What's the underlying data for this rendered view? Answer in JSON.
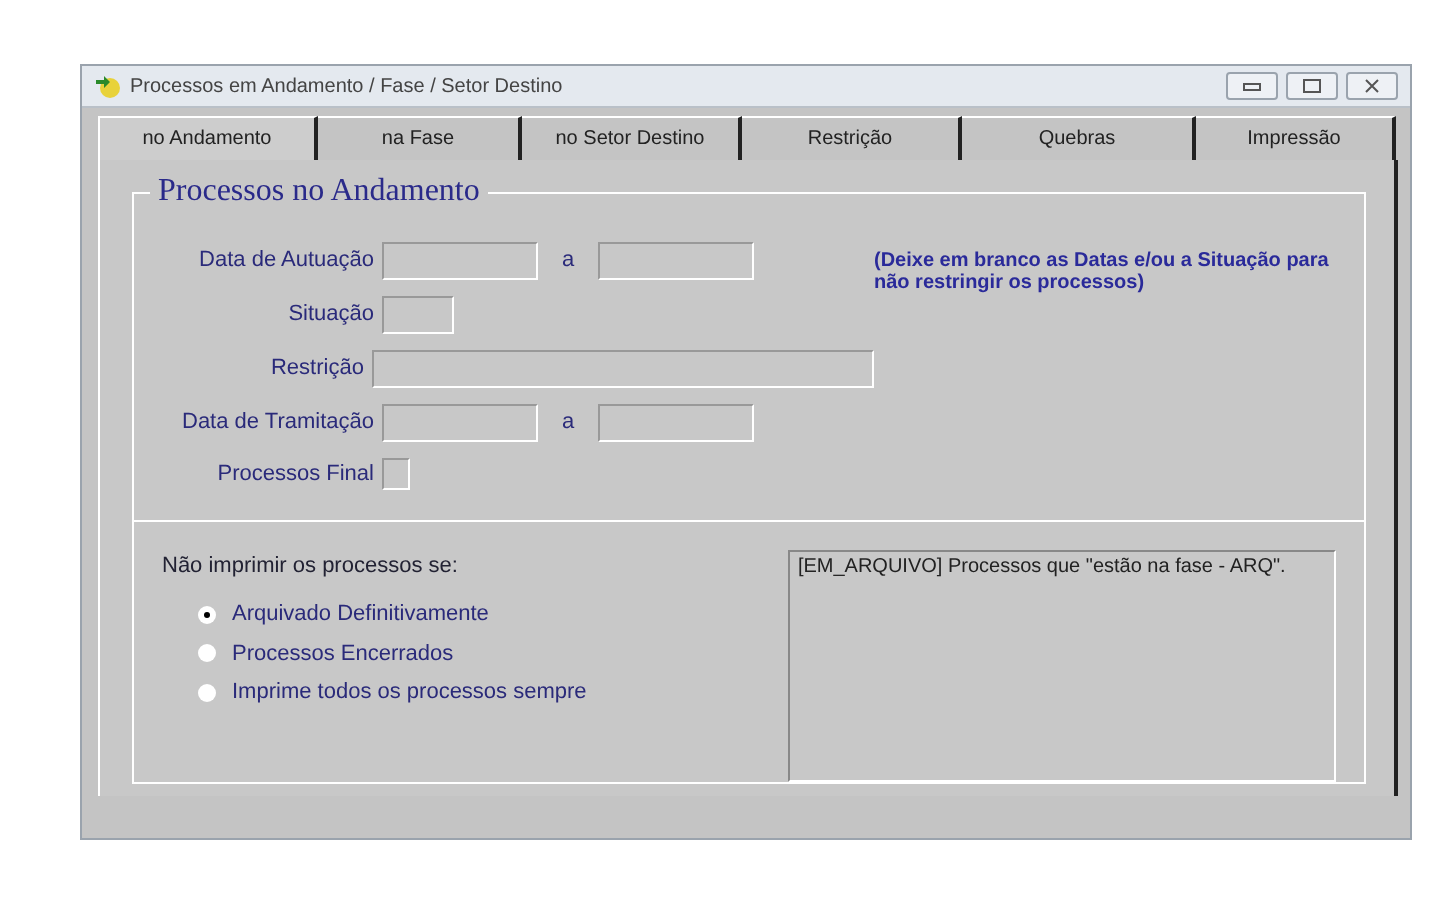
{
  "window": {
    "title": "Processos em Andamento / Fase / Setor Destino"
  },
  "tabs": [
    {
      "label": "no Andamento",
      "selected": true
    },
    {
      "label": "na Fase",
      "selected": false
    },
    {
      "label": "no Setor Destino",
      "selected": false
    },
    {
      "label": "Restrição",
      "selected": false
    },
    {
      "label": "Quebras",
      "selected": false
    },
    {
      "label": "Impressão",
      "selected": false
    }
  ],
  "group": {
    "title": "Processos no Andamento",
    "hint": "(Deixe em branco as Datas e/ou a Situação para não restringir os processos)",
    "fields": [
      {
        "kind": "range",
        "label": "Data de Autuação",
        "separator": "a"
      },
      {
        "kind": "short",
        "label": "Situação"
      },
      {
        "kind": "wide",
        "label": "Restrição"
      },
      {
        "kind": "range",
        "label": "Data de Tramitação",
        "separator": "a"
      },
      {
        "kind": "checkbox",
        "label": "Processos Final",
        "checked": false
      }
    ]
  },
  "print_options": {
    "label": "Não imprimir os processos se:",
    "options": [
      {
        "label": "Arquivado Definitivamente",
        "selected": true
      },
      {
        "label": "Processos Encerrados",
        "selected": false
      },
      {
        "label": "Imprime todos os processos sempre",
        "selected": false
      }
    ]
  },
  "description": "[EM_ARQUIVO] Processos que \"estão na fase - ARQ\"."
}
